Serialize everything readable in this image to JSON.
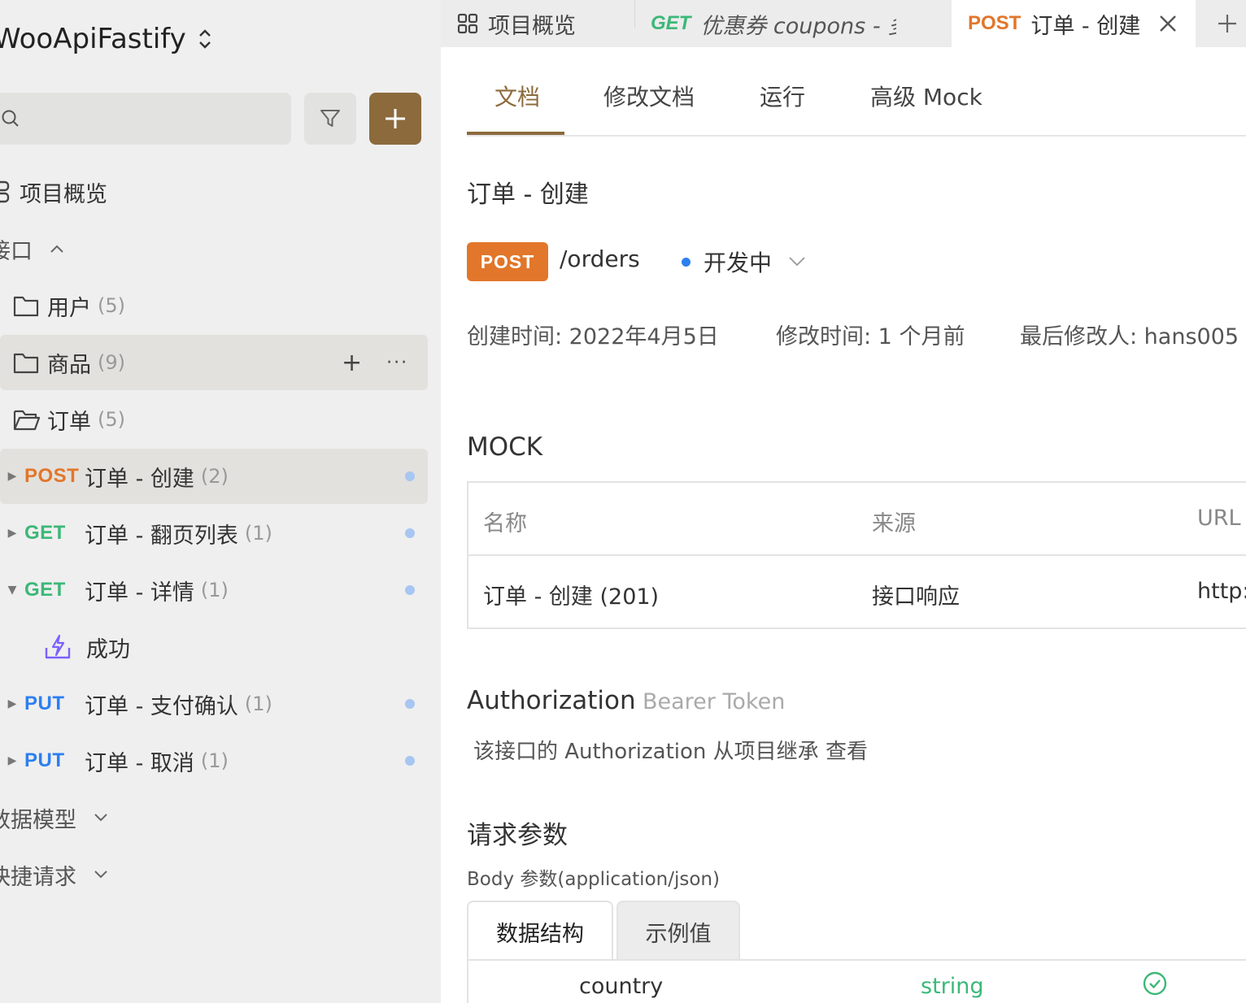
{
  "sidebar": {
    "project_name": "WooApiFastify",
    "search_placeholder": "",
    "overview_label": "项目概览",
    "interfaces_label": "接口",
    "folders": [
      {
        "label": "用户",
        "count": "(5)"
      },
      {
        "label": "商品",
        "count": "(9)"
      },
      {
        "label": "订单",
        "count": "(5)"
      }
    ],
    "endpoints": [
      {
        "method": "POST",
        "label": "订单 - 创建",
        "count": "(2)"
      },
      {
        "method": "GET",
        "label": "订单 - 翻页列表",
        "count": "(1)"
      },
      {
        "method": "GET",
        "label": "订单 - 详情",
        "count": "(1)"
      },
      {
        "method": "PUT",
        "label": "订单 - 支付确认",
        "count": "(1)"
      },
      {
        "method": "PUT",
        "label": "订单 - 取消",
        "count": "(1)"
      }
    ],
    "case_label": "成功",
    "data_models_label": "数据模型",
    "quick_requests_label": "快捷请求"
  },
  "tabs": [
    {
      "method": "",
      "label": "项目概览"
    },
    {
      "method": "GET",
      "label": "优惠券 coupons - 多"
    },
    {
      "method": "POST",
      "label": "订单 - 创建"
    }
  ],
  "subtabs": [
    "文档",
    "修改文档",
    "运行",
    "高级 Mock"
  ],
  "doc": {
    "title": "订单 - 创建",
    "method": "POST",
    "path": "/orders",
    "status": "开发中",
    "created": "创建时间: 2022年4月5日",
    "modified": "修改时间: 1 个月前",
    "modified_by": "最后修改人: hans005"
  },
  "mock": {
    "heading": "MOCK",
    "headers": [
      "名称",
      "来源",
      "URL"
    ],
    "rows": [
      [
        "订单 - 创建 (201)",
        "接口响应",
        "http:"
      ]
    ]
  },
  "auth": {
    "title": "Authorization",
    "type": "Bearer Token",
    "note": "该接口的 Authorization 从项目继承",
    "link": "查看"
  },
  "request": {
    "heading": "请求参数",
    "body_sub": "Body 参数(application/json)",
    "tabs": [
      "数据结构",
      "示例值"
    ],
    "field_name": "country",
    "field_type": "string"
  },
  "colors": {
    "accent": "#8c6a3c",
    "post": "#e2762a",
    "get": "#3cb878",
    "put": "#2d7ff0"
  }
}
